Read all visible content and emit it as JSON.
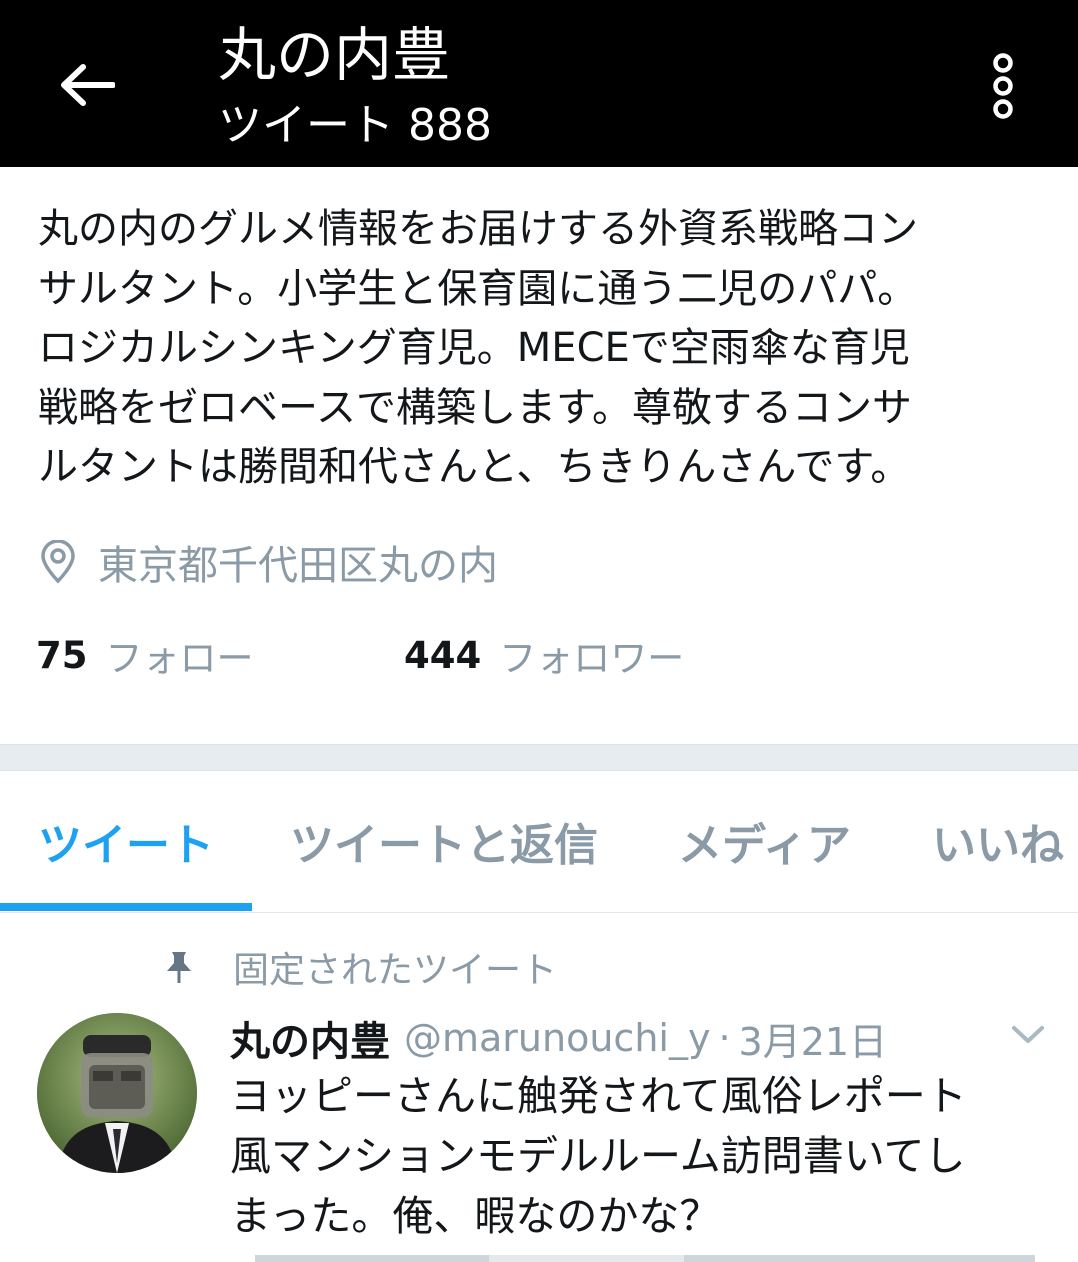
{
  "header": {
    "title": "丸の内豊",
    "subtitle": "ツイート 888",
    "back_icon": "arrow-left-icon",
    "more_icon": "more-vertical-icon"
  },
  "profile": {
    "bio": "丸の内のグルメ情報をお届けする外資系戦略コン\nサルタント。小学生と保育園に通う二児のパパ。\nロジカルシンキング育児。MECEで空雨傘な育児\n戦略をゼロベースで構築します。尊敬するコンサ\nルタントは勝間和代さんと、ちきりんさんです。",
    "location": "東京都千代田区丸の内",
    "following_count": "75",
    "following_label": "フォロー",
    "followers_count": "444",
    "followers_label": "フォロワー"
  },
  "tabs": [
    {
      "label": "ツイート",
      "active": true
    },
    {
      "label": "ツイートと返信",
      "active": false
    },
    {
      "label": "メディア",
      "active": false
    },
    {
      "label": "いいね",
      "active": false
    }
  ],
  "pinned_tweet": {
    "pinned_label": "固定されたツイート",
    "author_name": "丸の内豊",
    "handle": "@marunouchi_y",
    "separator": "·",
    "date": "3月21日",
    "text": "ヨッピーさんに触発されて風俗レポート\n風マンションモデルルーム訪問書いてし\nまった。俺、暇なのかな？"
  },
  "colors": {
    "accent": "#1da1f2",
    "header_bg": "#000000",
    "muted_text": "#8a9aa7"
  }
}
